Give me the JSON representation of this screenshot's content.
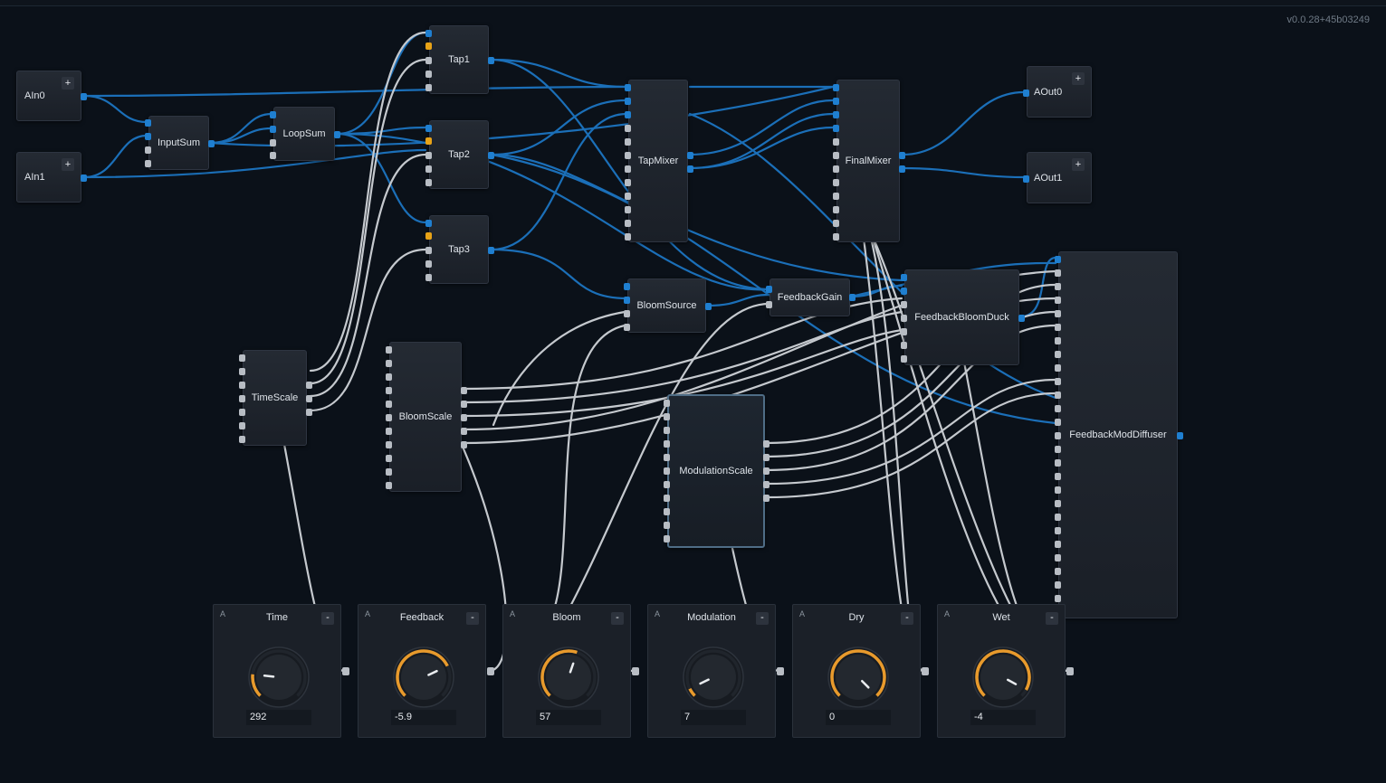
{
  "app": {
    "version": "v0.0.28+45b03249"
  },
  "colors": {
    "background": "#0b1119",
    "wire_audio": "#1b6fb8",
    "wire_control": "#c5c9ce",
    "knob_arc": "#e89a2c",
    "port_gate": "#e8a317"
  },
  "nodes": {
    "ain0": {
      "label": "AIn0",
      "button": "+"
    },
    "ain1": {
      "label": "AIn1",
      "button": "+"
    },
    "inputsum": {
      "label": "InputSum"
    },
    "loopsum": {
      "label": "LoopSum"
    },
    "tap1": {
      "label": "Tap1"
    },
    "tap2": {
      "label": "Tap2"
    },
    "tap3": {
      "label": "Tap3"
    },
    "tapmixer": {
      "label": "TapMixer"
    },
    "finalmixer": {
      "label": "FinalMixer"
    },
    "aout0": {
      "label": "AOut0",
      "button": "+"
    },
    "aout1": {
      "label": "AOut1",
      "button": "+"
    },
    "timescale": {
      "label": "TimeScale"
    },
    "bloomscale": {
      "label": "BloomScale"
    },
    "bloomsource": {
      "label": "BloomSource"
    },
    "feedbackgain": {
      "label": "FeedbackGain"
    },
    "feedbackbloomduck": {
      "label": "FeedbackBloomDuck"
    },
    "feedbackmoddiffuser": {
      "label": "FeedbackModDiffuser"
    },
    "modulationscale": {
      "label": "ModulationScale"
    }
  },
  "knobs": [
    {
      "title": "Time",
      "value": "292",
      "auto_label": "A",
      "collapse_label": "-",
      "level": 0.19
    },
    {
      "title": "Feedback",
      "value": "-5.9",
      "auto_label": "A",
      "collapse_label": "-",
      "level": 0.74
    },
    {
      "title": "Bloom",
      "value": "57",
      "auto_label": "A",
      "collapse_label": "-",
      "level": 0.57
    },
    {
      "title": "Modulation",
      "value": "7",
      "auto_label": "A",
      "collapse_label": "-",
      "level": 0.07
    },
    {
      "title": "Dry",
      "value": "0",
      "auto_label": "A",
      "collapse_label": "-",
      "level": 1.0
    },
    {
      "title": "Wet",
      "value": "-4",
      "auto_label": "A",
      "collapse_label": "-",
      "level": 0.94
    }
  ]
}
